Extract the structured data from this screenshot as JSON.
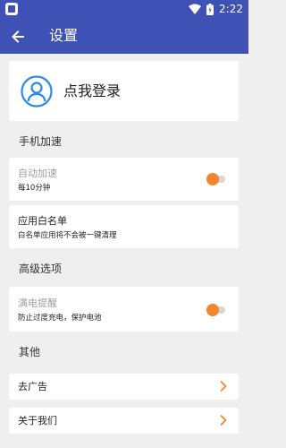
{
  "status": {
    "time": "2:22"
  },
  "appbar": {
    "title": "设置"
  },
  "login": {
    "label": "点我登录"
  },
  "sections": {
    "speed": "手机加速",
    "advanced": "高级选项",
    "other": "其他"
  },
  "auto_speed": {
    "title": "自动加速",
    "subtitle": "每10分钟",
    "enabled": true
  },
  "whitelist": {
    "title": "应用白名单",
    "subtitle": "白名单应用将不会被一键清理"
  },
  "full_charge": {
    "title": "满电提醒",
    "subtitle": "防止过度充电，保护电池",
    "enabled": true
  },
  "remove_ads": {
    "title": "去广告"
  },
  "about": {
    "title": "关于我们"
  },
  "colors": {
    "primary": "#3f51b5",
    "accent": "#f3862b",
    "icon_blue": "#2d8ae6"
  }
}
